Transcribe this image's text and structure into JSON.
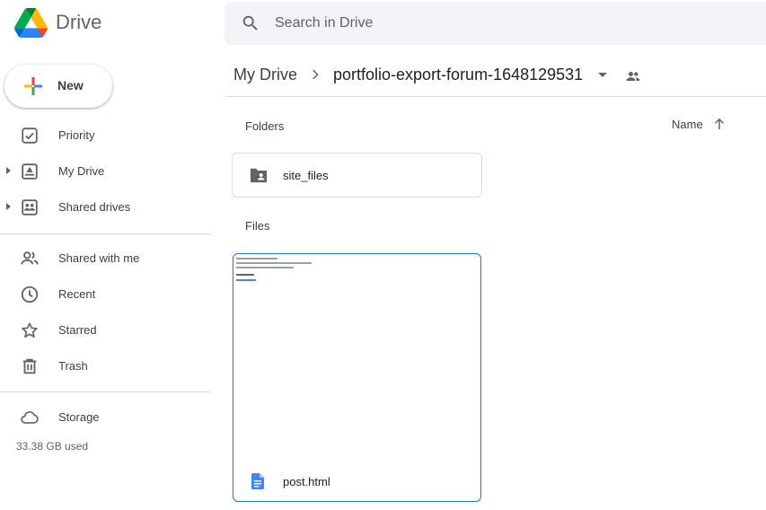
{
  "app": {
    "title": "Drive"
  },
  "search": {
    "placeholder": "Search in Drive"
  },
  "sidebar": {
    "new_label": "New",
    "items": [
      {
        "label": "Priority",
        "icon": "priority-icon"
      },
      {
        "label": "My Drive",
        "icon": "my-drive-icon"
      },
      {
        "label": "Shared drives",
        "icon": "shared-drives-icon"
      },
      {
        "label": "Shared with me",
        "icon": "shared-with-me-icon"
      },
      {
        "label": "Recent",
        "icon": "clock-icon"
      },
      {
        "label": "Starred",
        "icon": "star-icon"
      },
      {
        "label": "Trash",
        "icon": "trash-icon"
      },
      {
        "label": "Storage",
        "icon": "cloud-icon"
      }
    ],
    "storage_used": "33.38 GB used"
  },
  "breadcrumb": {
    "root": "My Drive",
    "current": "portfolio-export-forum-1648129531"
  },
  "main": {
    "folders_label": "Folders",
    "sort_label": "Name",
    "files_label": "Files",
    "folders": [
      {
        "name": "site_files"
      }
    ],
    "files": [
      {
        "name": "post.html"
      }
    ]
  },
  "colors": {
    "accent": "#1a73e8",
    "text": "#3c4043",
    "muted": "#5f6368",
    "search_bg": "#f1f3f4",
    "divider": "#dadce0"
  }
}
